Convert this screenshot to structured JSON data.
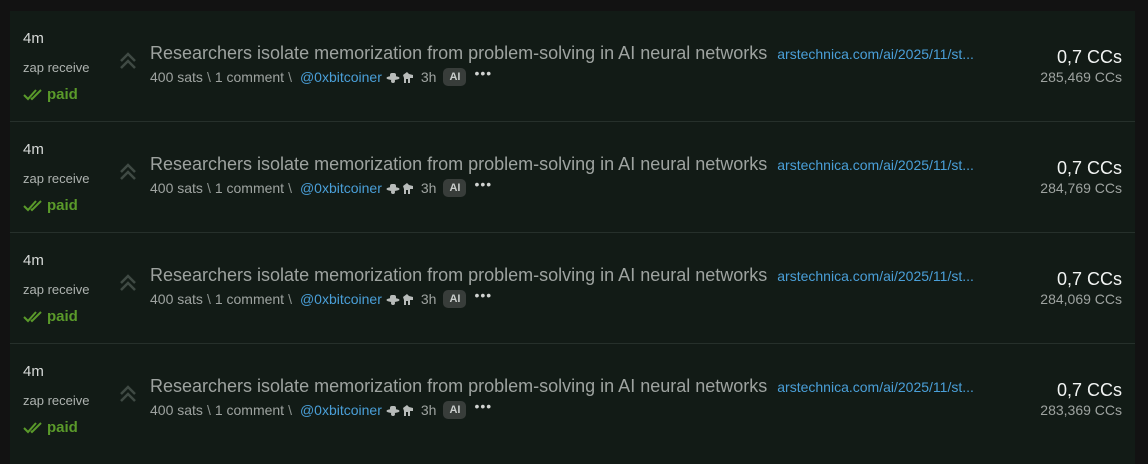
{
  "rows": [
    {
      "time": "4m",
      "kind": "zap receive",
      "status": "paid",
      "title": "Researchers isolate memorization from problem-solving in AI neural networks",
      "link": "arstechnica.com/ai/2025/11/st...",
      "sats": "400 sats",
      "comments": "1 comment",
      "user": "@0xbitcoiner",
      "age": "3h",
      "tag": "AI",
      "amount": "0,7 CCs",
      "balance": "285,469 CCs"
    },
    {
      "time": "4m",
      "kind": "zap receive",
      "status": "paid",
      "title": "Researchers isolate memorization from problem-solving in AI neural networks",
      "link": "arstechnica.com/ai/2025/11/st...",
      "sats": "400 sats",
      "comments": "1 comment",
      "user": "@0xbitcoiner",
      "age": "3h",
      "tag": "AI",
      "amount": "0,7 CCs",
      "balance": "284,769 CCs"
    },
    {
      "time": "4m",
      "kind": "zap receive",
      "status": "paid",
      "title": "Researchers isolate memorization from problem-solving in AI neural networks",
      "link": "arstechnica.com/ai/2025/11/st...",
      "sats": "400 sats",
      "comments": "1 comment",
      "user": "@0xbitcoiner",
      "age": "3h",
      "tag": "AI",
      "amount": "0,7 CCs",
      "balance": "284,069 CCs"
    },
    {
      "time": "4m",
      "kind": "zap receive",
      "status": "paid",
      "title": "Researchers isolate memorization from problem-solving in AI neural networks",
      "link": "arstechnica.com/ai/2025/11/st...",
      "sats": "400 sats",
      "comments": "1 comment",
      "user": "@0xbitcoiner",
      "age": "3h",
      "tag": "AI",
      "amount": "0,7 CCs",
      "balance": "283,369 CCs"
    }
  ],
  "separators": {
    "slash": "\\"
  },
  "icons": {
    "upvote": "double-chevron-up-icon",
    "status": "double-check-icon",
    "badges": [
      "cowboy-hat-icon",
      "horse-icon"
    ],
    "more": "ellipsis-icon"
  },
  "colors": {
    "page_bg": "#121212",
    "panel_bg": "#121b16",
    "link": "#4a9fd8",
    "paid": "#5a9a2a",
    "muted": "#9ea3a0"
  }
}
